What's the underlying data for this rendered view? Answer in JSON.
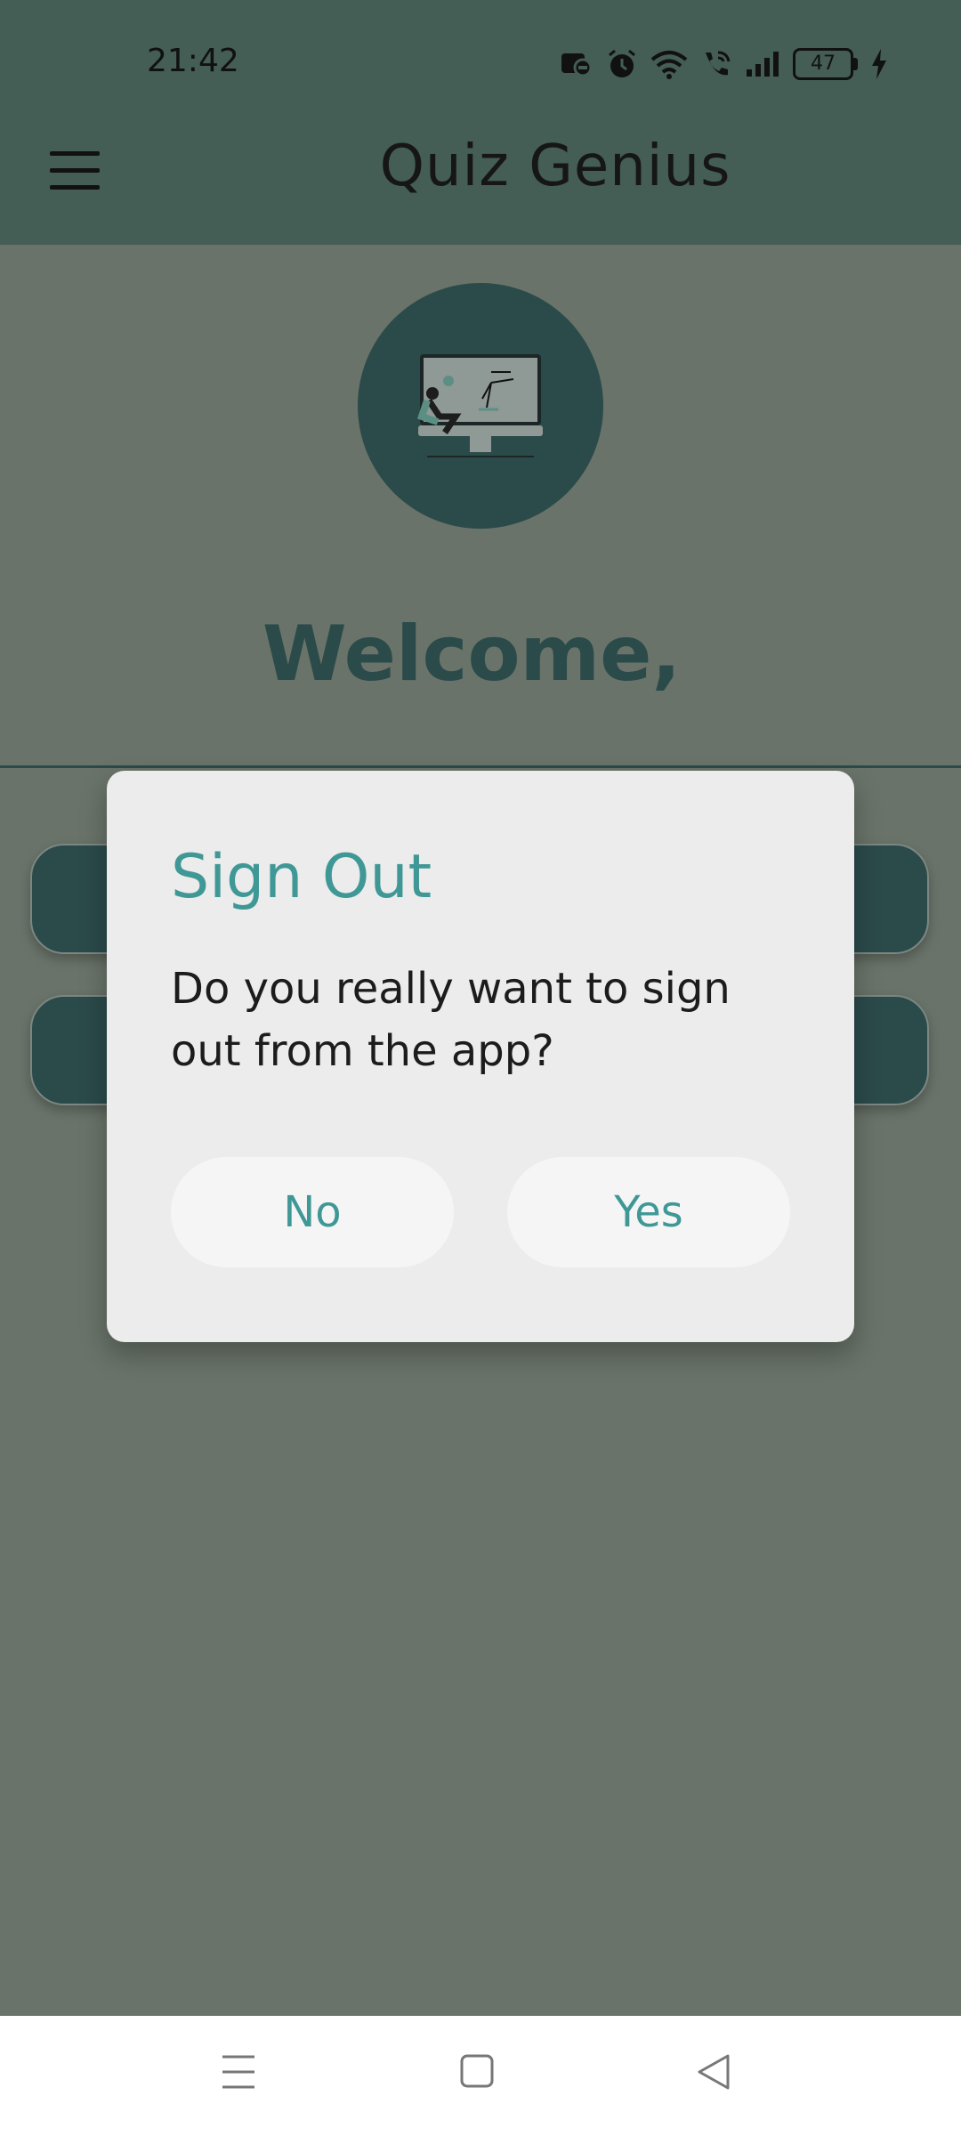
{
  "status_bar": {
    "time": "21:42",
    "battery_level": "47",
    "icons": [
      "messenger-icon",
      "alarm-icon",
      "wifi-icon",
      "wifi-calling-icon",
      "signal-icon",
      "battery-icon",
      "charging-icon"
    ]
  },
  "app_bar": {
    "title": "Quiz Genius",
    "menu_icon": "hamburger-menu-icon"
  },
  "main": {
    "welcome": "Welcome,"
  },
  "dialog": {
    "title": "Sign Out",
    "message": "Do you really want to sign out from the app?",
    "no_label": "No",
    "yes_label": "Yes"
  },
  "colors": {
    "primary_dark": "#2b4a4a",
    "accent": "#3f9896",
    "scrim_background": "#697369",
    "dialog_background": "#ececec"
  },
  "nav_bar": {
    "icons": [
      "recents-icon",
      "home-icon",
      "back-icon"
    ]
  }
}
